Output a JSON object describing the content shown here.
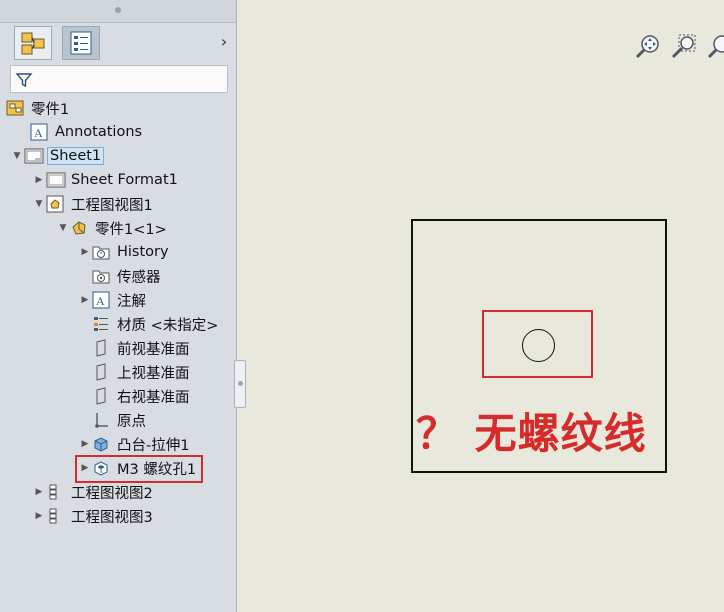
{
  "tree": {
    "root": "零件1",
    "annotations": "Annotations",
    "sheet": "Sheet1",
    "sheet_format": "Sheet Format1",
    "view1": "工程图视图1",
    "part": "零件1<1>",
    "history": "History",
    "sensors": "传感器",
    "notes": "注解",
    "material": "材质 <未指定>",
    "front_plane": "前视基准面",
    "top_plane": "上视基准面",
    "right_plane": "右视基准面",
    "origin": "原点",
    "boss_extrude": "凸台-拉伸1",
    "m3_hole": "M3 螺纹孔1",
    "view2": "工程图视图2",
    "view3": "工程图视图3"
  },
  "annotation": {
    "text": "？ 无螺纹线"
  },
  "colors": {
    "highlight_red": "#d52b2b",
    "panel_bg": "#d7dde3",
    "canvas_bg": "#e8e8dc",
    "selection": "#cfe3f6"
  },
  "icons": [
    "tree-tab-icon",
    "property-tab-icon",
    "filter-icon",
    "zoom-to-fit-icon",
    "zoom-area-icon",
    "zoom-icon"
  ]
}
